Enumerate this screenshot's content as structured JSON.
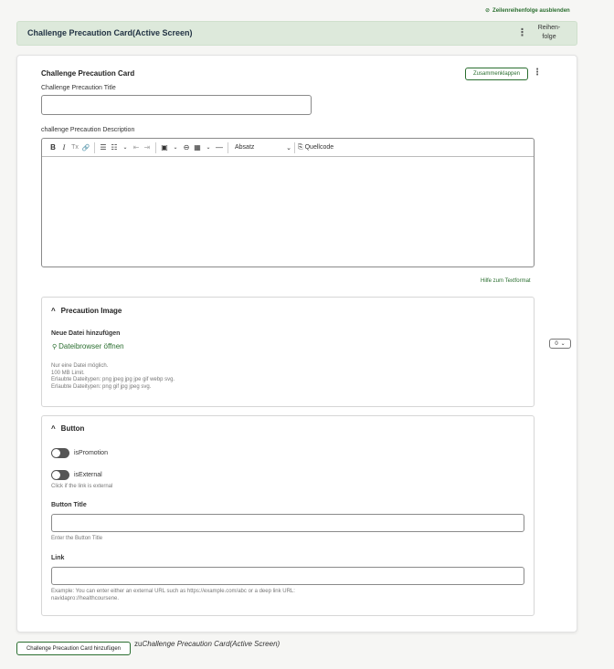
{
  "top": {
    "toggle_order_label": "Zeilenreihenfolge ausblenden"
  },
  "paragraph_header": {
    "title": "Challenge Precaution Card(Active Screen)",
    "order_label": "Reihen-folge"
  },
  "card": {
    "title": "Challenge Precaution Card",
    "collapse_label": "Zusammenklappen",
    "title_field_label": "Challenge Precaution Title",
    "title_field_value": "",
    "description_label": "challenge Precaution Description",
    "toolbar": {
      "bold": "B",
      "italic": "I",
      "clear": "Tx",
      "link": "🔗",
      "bullets": "☰",
      "numbers": "☷",
      "outdent": "⇤",
      "indent": "⇥",
      "image": "▣",
      "embed": "⊖",
      "table": "▦",
      "hr": "—",
      "format": "Absatz",
      "source": "Quellcode"
    },
    "help_link": "Hilfe zum Textformat",
    "image_section": {
      "title": "Precaution Image",
      "add_file_label": "Neue Datei hinzufügen",
      "file_browser": "Dateibrowser öffnen",
      "hint_1": "Nur eine Datei möglich.",
      "hint_2": "100 MB Limit.",
      "hint_3": "Erlaubte Dateitypen: png jpeg jpg jpe gif webp svg.",
      "hint_4": "Erlaubte Dateitypen: png gif jpg jpeg svg."
    },
    "button_section": {
      "title": "Button",
      "is_promotion": "isPromotion",
      "is_external": "isExternal",
      "is_external_hint": "Click if the link is external",
      "button_title_label": "Button Title",
      "button_title_hint": "Enter the Button Title",
      "link_label": "Link",
      "link_hint_1": "Example: You can enter either an external URL such as https://example.com/abc or a deep link URL:",
      "link_hint_2": "navidapro://healthcoursene."
    },
    "weight_value": "0"
  },
  "footer": {
    "add_button": "Challenge Precaution Card hinzufügen",
    "add_suffix_prefix": "zu",
    "add_suffix_target": "Challenge Precaution Card(Active Screen)"
  },
  "colors": {
    "accent": "#2a6e2f",
    "header_bg": "#dde9db"
  }
}
